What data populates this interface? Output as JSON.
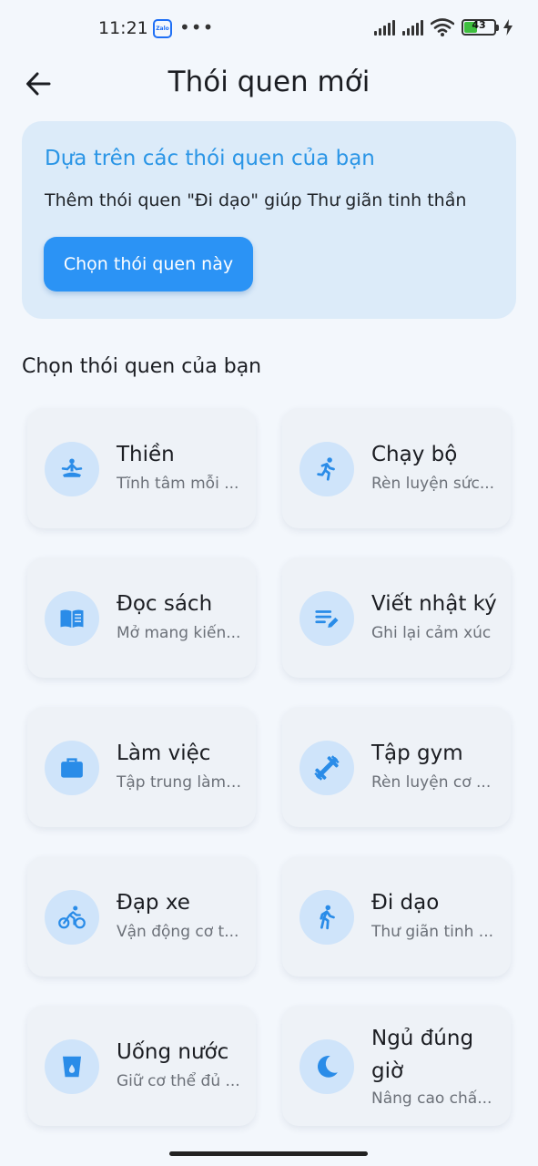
{
  "status_bar": {
    "time": "11:21",
    "battery": "43",
    "battery_level": 0.43
  },
  "header": {
    "title": "Thói quen mới"
  },
  "suggestion": {
    "title": "Dựa trên các thói quen của bạn",
    "text": "Thêm thói quen \"Đi dạo\" giúp Thư giãn tinh thần",
    "button_label": "Chọn thói quen này"
  },
  "section_title": "Chọn thói quen của bạn",
  "habits": [
    {
      "name": "Thiền",
      "desc": "Tĩnh tâm mỗi ...",
      "icon": "meditation-icon"
    },
    {
      "name": "Chạy bộ",
      "desc": "Rèn luyện sức...",
      "icon": "running-icon"
    },
    {
      "name": "Đọc sách",
      "desc": "Mở mang kiến...",
      "icon": "book-icon"
    },
    {
      "name": "Viết nhật ký",
      "desc": "Ghi lại cảm xúc",
      "icon": "edit-note-icon"
    },
    {
      "name": "Làm việc",
      "desc": "Tập trung làm ...",
      "icon": "briefcase-icon"
    },
    {
      "name": "Tập gym",
      "desc": "Rèn luyện cơ ...",
      "icon": "dumbbell-icon"
    },
    {
      "name": "Đạp xe",
      "desc": "Vận động cơ t...",
      "icon": "bicycle-icon"
    },
    {
      "name": "Đi dạo",
      "desc": "Thư giãn tinh ...",
      "icon": "walking-icon"
    },
    {
      "name": "Uống nước",
      "desc": "Giữ cơ thể đủ ...",
      "icon": "water-glass-icon"
    },
    {
      "name": "Ngủ đúng giờ",
      "desc": "Nâng cao chấ...",
      "icon": "moon-icon"
    }
  ],
  "colors": {
    "accent": "#2b93f5",
    "icon": "#2a8ce8",
    "icon_bg": "#cfe4fa",
    "card_bg": "#eef2f7",
    "suggestion_bg": "#dcebf9"
  }
}
